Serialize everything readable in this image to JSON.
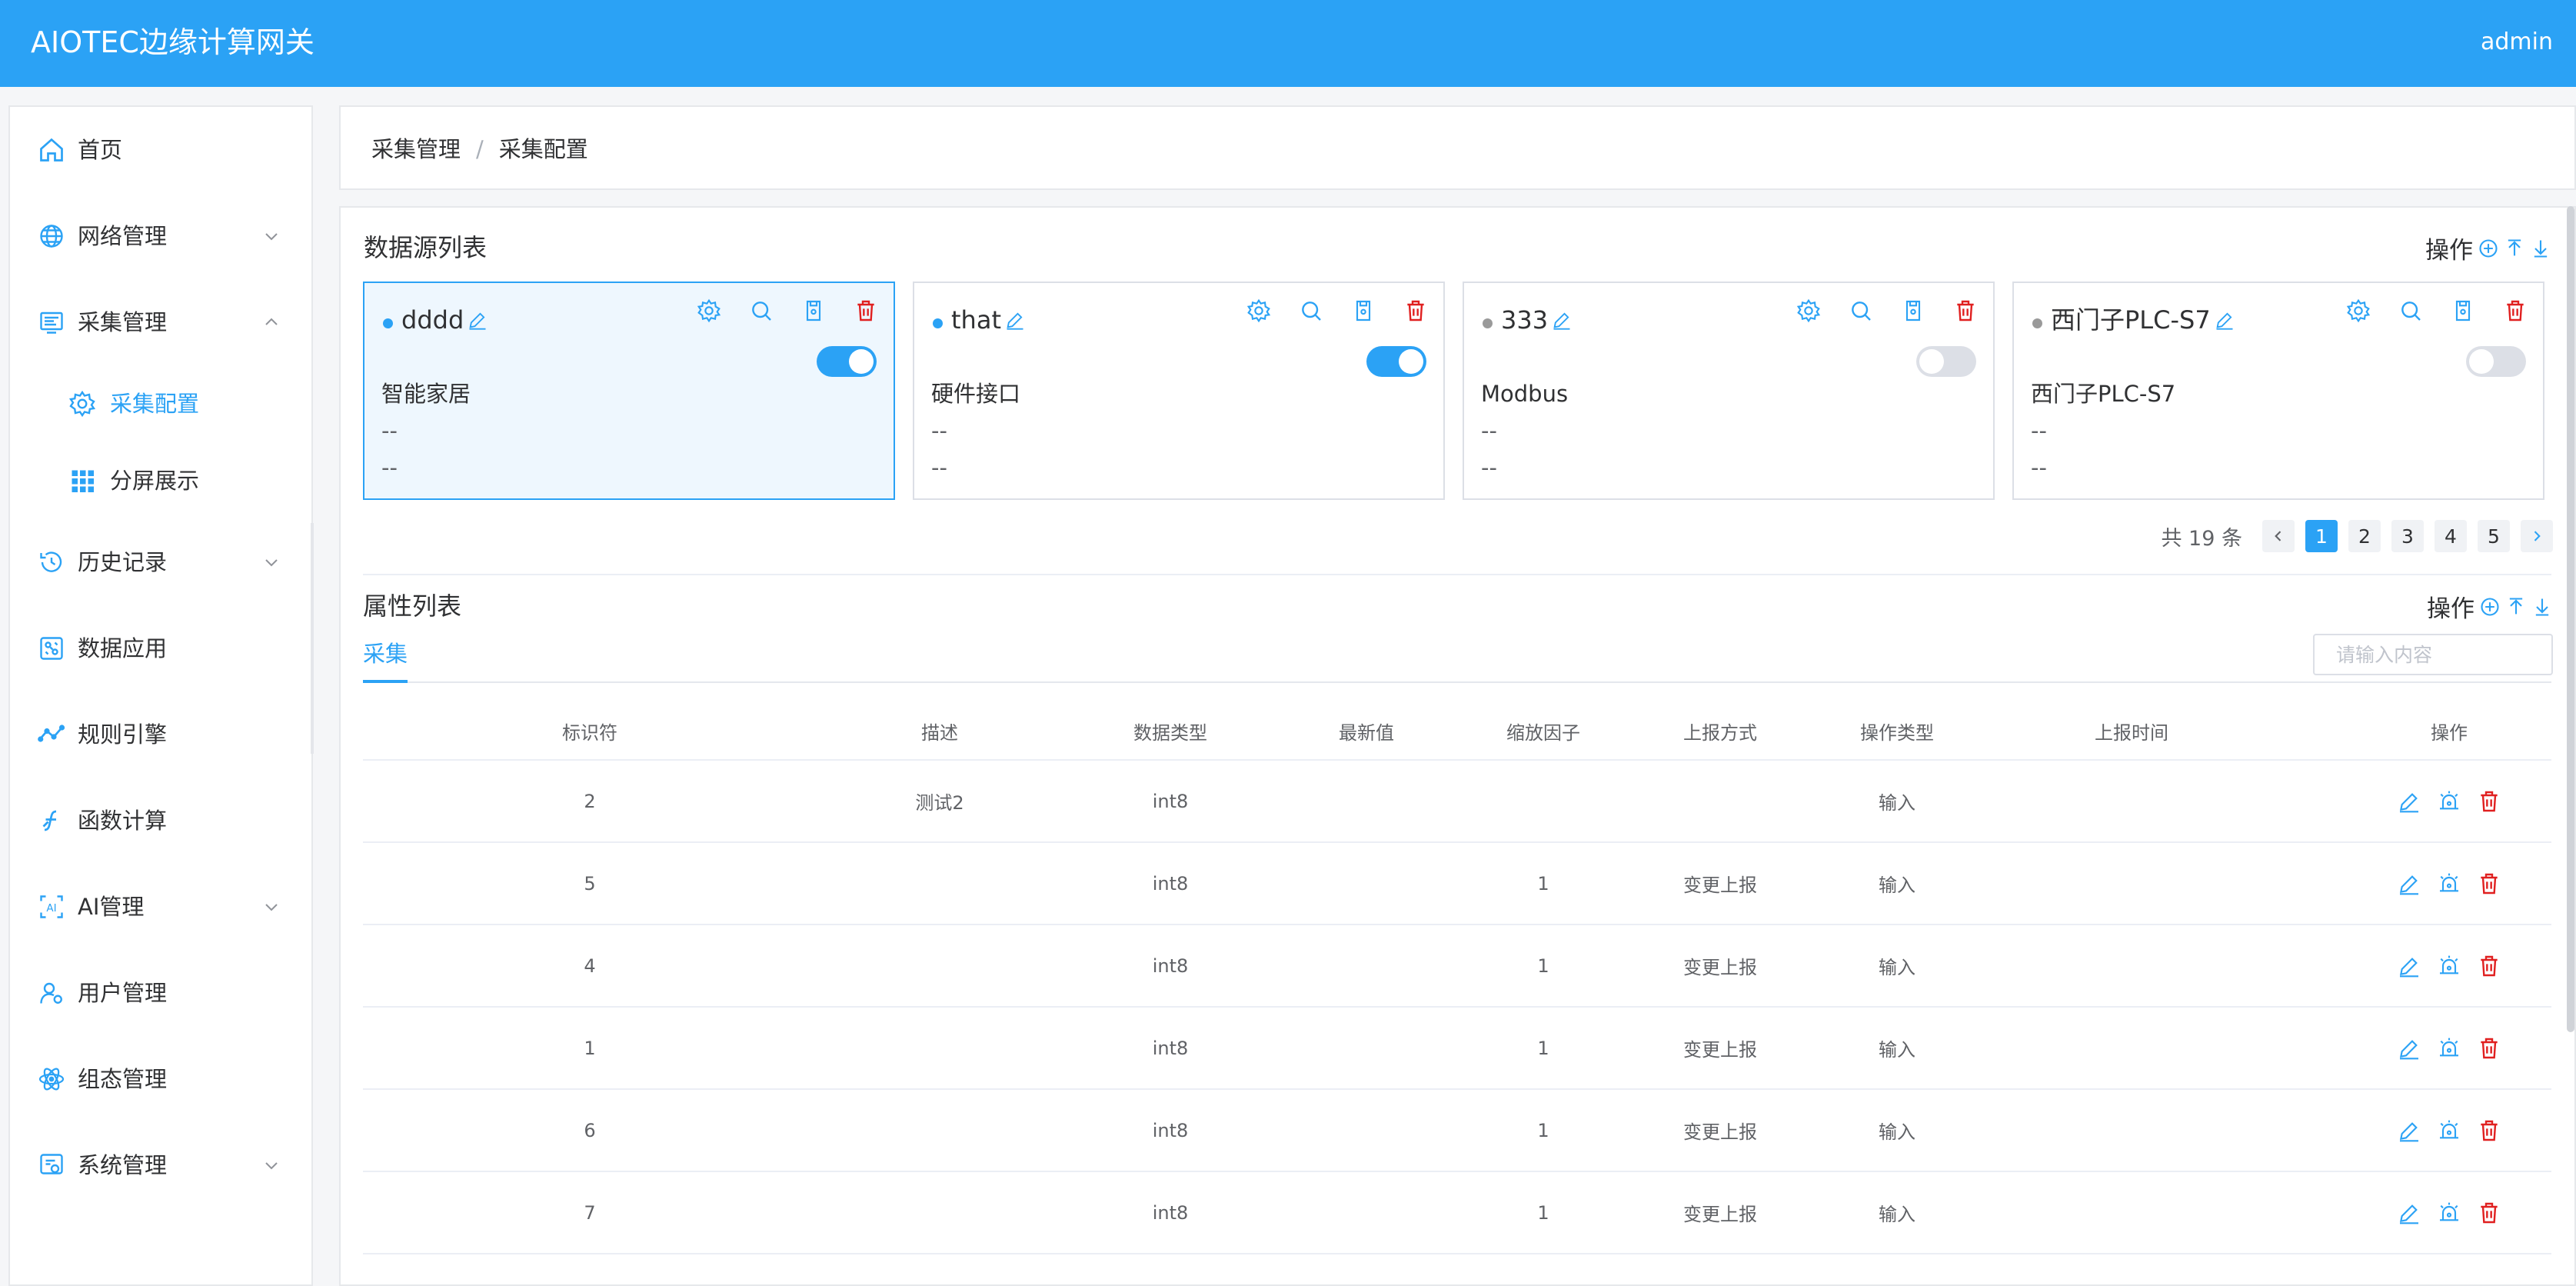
{
  "header": {
    "title": "AIOTEC边缘计算网关",
    "user": "admin"
  },
  "colors": {
    "accent": "#2ba2f5",
    "danger": "#e02020",
    "status_on": "#2ba2f5",
    "status_off": "#9a9a9a"
  },
  "sidebar": {
    "items": [
      {
        "label": "首页",
        "icon": "home-icon"
      },
      {
        "label": "网络管理",
        "icon": "globe-icon",
        "expandable": true
      },
      {
        "label": "采集管理",
        "icon": "collect-icon",
        "expandable": true,
        "expanded": true
      },
      {
        "label": "采集配置",
        "icon": "gear-cog-icon",
        "sub": true,
        "active": true
      },
      {
        "label": "分屏展示",
        "icon": "grid-icon",
        "sub": true
      },
      {
        "label": "历史记录",
        "icon": "history-icon",
        "expandable": true
      },
      {
        "label": "数据应用",
        "icon": "data-app-icon"
      },
      {
        "label": "规则引擎",
        "icon": "rule-engine-icon"
      },
      {
        "label": "函数计算",
        "icon": "function-icon"
      },
      {
        "label": "AI管理",
        "icon": "ai-icon",
        "expandable": true
      },
      {
        "label": "用户管理",
        "icon": "user-icon"
      },
      {
        "label": "组态管理",
        "icon": "atom-icon"
      },
      {
        "label": "系统管理",
        "icon": "system-icon",
        "expandable": true
      }
    ]
  },
  "breadcrumb": {
    "parent": "采集管理",
    "current": "采集配置",
    "separator": "/"
  },
  "datasource": {
    "title": "数据源列表",
    "ops_label": "操作",
    "cards": [
      {
        "name": "dddd",
        "enabled": true,
        "online": true,
        "desc": "智能家居",
        "line1": "--",
        "line2": "--"
      },
      {
        "name": "that",
        "enabled": true,
        "online": true,
        "desc": "硬件接口",
        "line1": "--",
        "line2": "--"
      },
      {
        "name": "333",
        "enabled": false,
        "online": false,
        "desc": "Modbus",
        "line1": "--",
        "line2": "--"
      },
      {
        "name": "西门子PLC-S7",
        "enabled": false,
        "online": false,
        "desc": "西门子PLC-S7",
        "line1": "--",
        "line2": "--"
      }
    ],
    "pager": {
      "total": "共 19 条",
      "pages": [
        "1",
        "2",
        "3",
        "4",
        "5"
      ],
      "current": "1"
    }
  },
  "attributes": {
    "title": "属性列表",
    "ops_label": "操作",
    "search_placeholder": "请输入内容",
    "tab": "采集",
    "columns": [
      "标识符",
      "描述",
      "数据类型",
      "最新值",
      "缩放因子",
      "上报方式",
      "操作类型",
      "上报时间",
      "操作"
    ],
    "rows": [
      {
        "id": "2",
        "desc": "测试2",
        "type": "int8",
        "latest": "",
        "scale": "",
        "report": "",
        "optype": "输入",
        "time": ""
      },
      {
        "id": "5",
        "desc": "",
        "type": "int8",
        "latest": "",
        "scale": "1",
        "report": "变更上报",
        "optype": "输入",
        "time": ""
      },
      {
        "id": "4",
        "desc": "",
        "type": "int8",
        "latest": "",
        "scale": "1",
        "report": "变更上报",
        "optype": "输入",
        "time": ""
      },
      {
        "id": "1",
        "desc": "",
        "type": "int8",
        "latest": "",
        "scale": "1",
        "report": "变更上报",
        "optype": "输入",
        "time": ""
      },
      {
        "id": "6",
        "desc": "",
        "type": "int8",
        "latest": "",
        "scale": "1",
        "report": "变更上报",
        "optype": "输入",
        "time": ""
      },
      {
        "id": "7",
        "desc": "",
        "type": "int8",
        "latest": "",
        "scale": "1",
        "report": "变更上报",
        "optype": "输入",
        "time": ""
      }
    ]
  }
}
